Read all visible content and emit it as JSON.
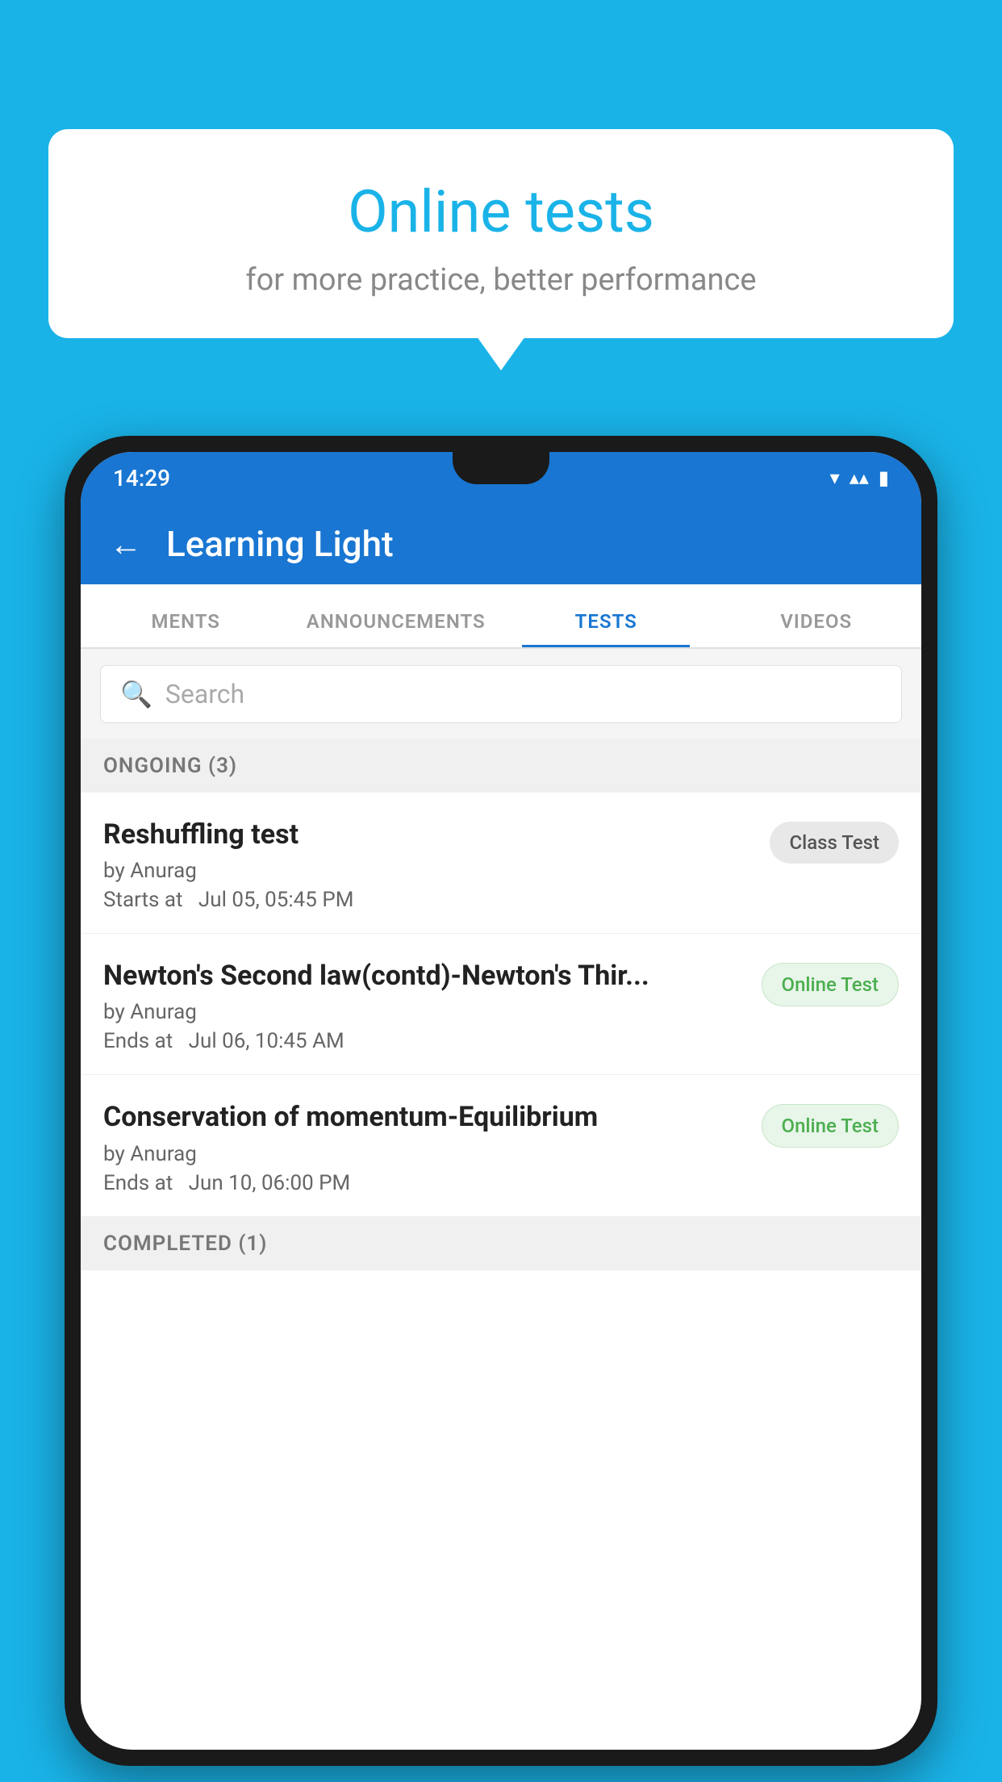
{
  "background_color": "#1ab3e8",
  "bubble": {
    "title": "Online tests",
    "subtitle": "for more practice, better performance"
  },
  "phone": {
    "status_bar": {
      "time": "14:29",
      "icons": "▾◂▮"
    },
    "app_bar": {
      "title": "Learning Light",
      "back_icon": "←"
    },
    "tabs": [
      {
        "label": "MENTS",
        "active": false
      },
      {
        "label": "ANNOUNCEMENTS",
        "active": false
      },
      {
        "label": "TESTS",
        "active": true
      },
      {
        "label": "VIDEOS",
        "active": false
      }
    ],
    "search": {
      "placeholder": "Search"
    },
    "section_ongoing": "ONGOING (3)",
    "tests": [
      {
        "name": "Reshuffling test",
        "author": "by Anurag",
        "time_label": "Starts at",
        "time": "Jul 05, 05:45 PM",
        "badge": "Class Test",
        "badge_type": "class"
      },
      {
        "name": "Newton's Second law(contd)-Newton's Thir...",
        "author": "by Anurag",
        "time_label": "Ends at",
        "time": "Jul 06, 10:45 AM",
        "badge": "Online Test",
        "badge_type": "online"
      },
      {
        "name": "Conservation of momentum-Equilibrium",
        "author": "by Anurag",
        "time_label": "Ends at",
        "time": "Jun 10, 06:00 PM",
        "badge": "Online Test",
        "badge_type": "online"
      }
    ],
    "section_completed": "COMPLETED (1)"
  }
}
